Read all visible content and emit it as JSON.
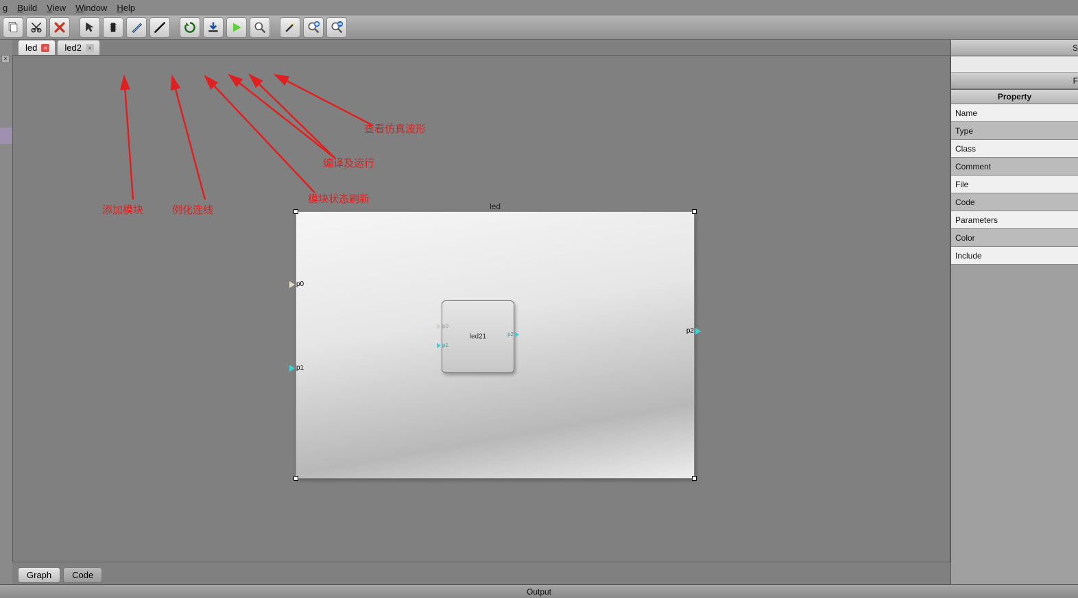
{
  "menu": {
    "items": [
      "g",
      "Build",
      "View",
      "Window",
      "Help"
    ],
    "underline": [
      null,
      "B",
      "V",
      "W",
      "H"
    ]
  },
  "toolbar": {
    "buttons": [
      {
        "name": "copy",
        "icon": "copy"
      },
      {
        "name": "cut",
        "icon": "scissors"
      },
      {
        "name": "delete",
        "icon": "x-red"
      },
      {
        "sep": true
      },
      {
        "name": "pointer",
        "icon": "cursor"
      },
      {
        "name": "add-module",
        "icon": "chip"
      },
      {
        "name": "brush",
        "icon": "brush"
      },
      {
        "name": "wire",
        "icon": "pen"
      },
      {
        "sep": true
      },
      {
        "name": "refresh",
        "icon": "cycle"
      },
      {
        "name": "download",
        "icon": "download"
      },
      {
        "name": "run",
        "icon": "play-green"
      },
      {
        "name": "wave",
        "icon": "magnifier"
      },
      {
        "sep": true
      },
      {
        "name": "wand",
        "icon": "wand"
      },
      {
        "name": "zoom-in",
        "icon": "zoom-plus"
      },
      {
        "name": "zoom-out",
        "icon": "zoom-minus"
      }
    ]
  },
  "tabs": [
    {
      "label": "led",
      "active": true,
      "closeStyle": "red"
    },
    {
      "label": "led2",
      "active": false,
      "closeStyle": "gray"
    }
  ],
  "viewtabs": [
    {
      "label": "Graph",
      "active": true
    },
    {
      "label": "Code",
      "active": false
    }
  ],
  "outerModule": {
    "title": "led",
    "ports": {
      "p0": "p0",
      "p1": "p1",
      "p2": "p2"
    }
  },
  "innerModule": {
    "label": "led21",
    "ports": {
      "p0": "p0",
      "p1": "p1",
      "p2": "p2"
    }
  },
  "annotations": {
    "add_module": "添加模块",
    "instantiate_wire": "例化连线",
    "refresh_state": "模块状态刷新",
    "compile_run": "编译及运行",
    "view_wave": "查看仿真波形"
  },
  "rightPanel": {
    "header_letter": "S",
    "sub_letter": "F",
    "propHeader": "Property",
    "rows": [
      {
        "label": "Name",
        "bg": "white"
      },
      {
        "label": "Type",
        "bg": "gray"
      },
      {
        "label": "Class",
        "bg": "white"
      },
      {
        "label": "Comment",
        "bg": "gray"
      },
      {
        "label": "File",
        "bg": "white"
      },
      {
        "label": "Code",
        "bg": "gray"
      },
      {
        "label": "Parameters",
        "bg": "white"
      },
      {
        "label": "Color",
        "bg": "gray"
      },
      {
        "label": "Include",
        "bg": "white"
      }
    ]
  },
  "output": {
    "label": "Output"
  }
}
